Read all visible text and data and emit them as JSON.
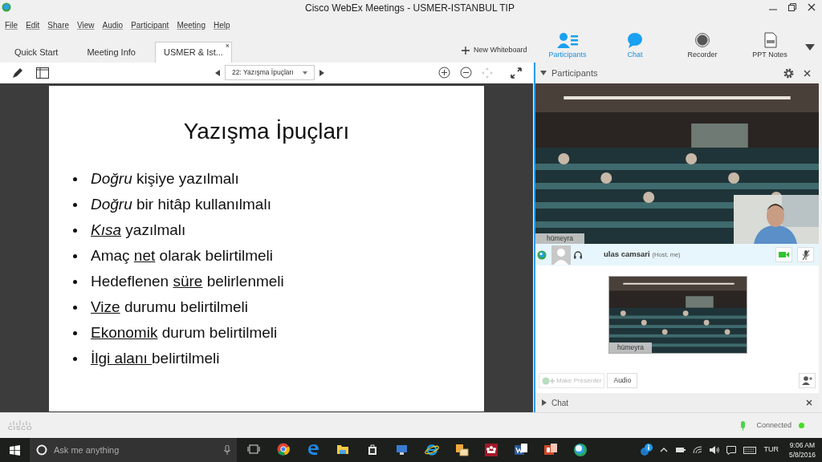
{
  "window": {
    "title": "Cisco WebEx Meetings - USMER-ISTANBUL TIP"
  },
  "menu": [
    "File",
    "Edit",
    "Share",
    "View",
    "Audio",
    "Participant",
    "Meeting",
    "Help"
  ],
  "tabs": [
    {
      "label": "Quick Start",
      "selected": false
    },
    {
      "label": "Meeting Info",
      "selected": false
    },
    {
      "label": "USMER & Ist...",
      "selected": true,
      "close": "×"
    }
  ],
  "new_whiteboard": "New Whiteboard",
  "panel_buttons": [
    {
      "kind": "participants",
      "label": "Participants",
      "selected": true
    },
    {
      "kind": "chat",
      "label": "Chat",
      "selected": true
    },
    {
      "kind": "recorder",
      "label": "Recorder",
      "selected": false
    },
    {
      "kind": "notes",
      "label": "PPT Notes",
      "selected": false
    }
  ],
  "slide_selector": "22: Yazışma İpuçları",
  "slide": {
    "title": "Yazışma İpuçları",
    "bullets": [
      {
        "segments": [
          {
            "text": "Doğru",
            "italic": true,
            "underline": false
          },
          {
            "text": " kişiye yazılmalı",
            "italic": false,
            "underline": false
          }
        ]
      },
      {
        "segments": [
          {
            "text": "Doğru",
            "italic": true,
            "underline": false
          },
          {
            "text": " bir hitâp kullanılmalı",
            "italic": false,
            "underline": false
          }
        ]
      },
      {
        "segments": [
          {
            "text": "Kısa",
            "italic": true,
            "underline": true
          },
          {
            "text": " yazılmalı",
            "italic": false,
            "underline": false
          }
        ]
      },
      {
        "segments": [
          {
            "text": "Amaç ",
            "italic": false,
            "underline": false
          },
          {
            "text": "net",
            "italic": false,
            "underline": true
          },
          {
            "text": " olarak belirtilmeli",
            "italic": false,
            "underline": false
          }
        ]
      },
      {
        "segments": [
          {
            "text": "Hedeflenen ",
            "italic": false,
            "underline": false
          },
          {
            "text": "süre",
            "italic": false,
            "underline": true
          },
          {
            "text": " belirlenmeli",
            "italic": false,
            "underline": false
          }
        ]
      },
      {
        "segments": [
          {
            "text": "Vize",
            "italic": false,
            "underline": true
          },
          {
            "text": " durumu belirtilmeli",
            "italic": false,
            "underline": false
          }
        ]
      },
      {
        "segments": [
          {
            "text": "Ekonomik",
            "italic": false,
            "underline": true
          },
          {
            "text": " durum belirtilmeli",
            "italic": false,
            "underline": false
          }
        ]
      },
      {
        "segments": [
          {
            "text": "İlgi alanı ",
            "italic": false,
            "underline": true
          },
          {
            "text": "belirtilmeli",
            "italic": false,
            "underline": false
          }
        ]
      }
    ]
  },
  "participants_panel": {
    "title": "Participants",
    "video_label": "hümeyra",
    "participant": {
      "name": "ulas camsari",
      "role": "(Host, me)",
      "video_on": true,
      "muted": true
    },
    "preview_label": "hümeyra",
    "make_presenter": "Make Presenter",
    "audio": "Audio"
  },
  "chat_panel": {
    "title": "Chat",
    "expanded": false
  },
  "status_bar": {
    "logo": "CISCO",
    "status": "Connected"
  },
  "taskbar": {
    "search_placeholder": "Ask me anything",
    "language": "TUR",
    "time": "9:06 AM",
    "date": "5/8/2016"
  }
}
